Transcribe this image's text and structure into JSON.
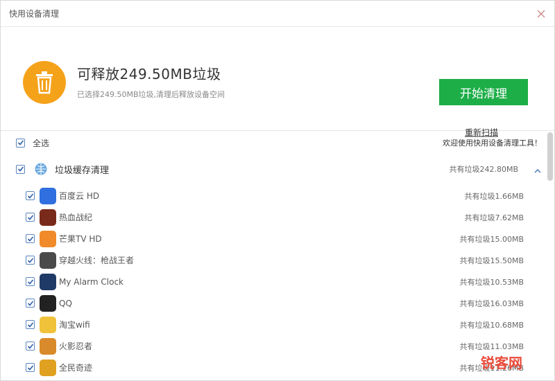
{
  "window": {
    "title": "快用设备清理",
    "close_icon": "close-icon"
  },
  "summary": {
    "icon": "trash-icon",
    "title": "可释放249.50MB垃圾",
    "subtitle": "已选择249.50MB垃圾,清理后释放设备空间",
    "start_button": "开始清理",
    "rescan_link": "重新扫描"
  },
  "list": {
    "select_all": {
      "label": "全选",
      "checked": true
    },
    "welcome": "欢迎使用快用设备清理工具！",
    "category": {
      "label": "垃圾缓存清理",
      "total": "共有垃圾242.80MB",
      "icon": "globe-icon",
      "collapse_icon": "chevron-up-icon",
      "checked": true
    },
    "apps": [
      {
        "name": "百度云 HD",
        "size": "共有垃圾1.66MB",
        "color": "#2f6fe0"
      },
      {
        "name": "热血战纪",
        "size": "共有垃圾7.62MB",
        "color": "#7a2a1a"
      },
      {
        "name": "芒果TV HD",
        "size": "共有垃圾15.00MB",
        "color": "#f08a2a"
      },
      {
        "name": "穿越火线：枪战王者",
        "size": "共有垃圾15.50MB",
        "color": "#4a4a4a"
      },
      {
        "name": "My Alarm Clock",
        "size": "共有垃圾10.53MB",
        "color": "#1f3a66"
      },
      {
        "name": "QQ",
        "size": "共有垃圾16.03MB",
        "color": "#222222"
      },
      {
        "name": "淘宝wifi",
        "size": "共有垃圾10.68MB",
        "color": "#f0c23a"
      },
      {
        "name": "火影忍者",
        "size": "共有垃圾11.03MB",
        "color": "#d98a2a"
      },
      {
        "name": "全民奇迹",
        "size": "共有垃圾11.26MB",
        "color": "#e0a020"
      }
    ]
  },
  "watermark": {
    "text": "锐客网"
  },
  "colors": {
    "accent_green": "#1dae48",
    "trash_orange": "#f5a21b",
    "checkbox_blue": "#5b86c0"
  }
}
